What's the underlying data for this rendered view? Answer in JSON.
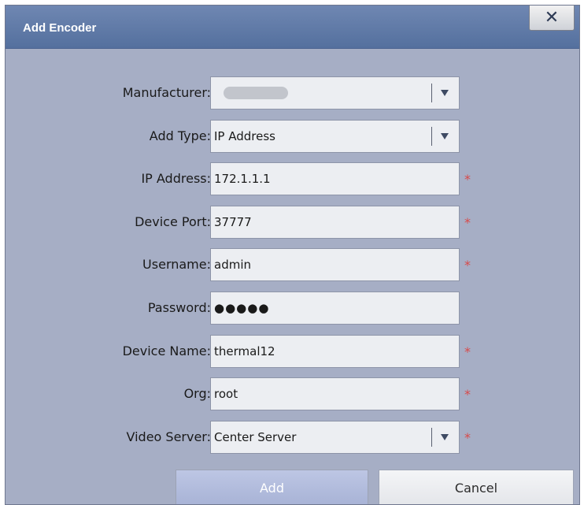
{
  "dialog": {
    "title": "Add Encoder",
    "close_label": "✕"
  },
  "form": {
    "manufacturer_label": "Manufacturer:",
    "add_type_label": "Add Type:",
    "add_type_value": "IP Address",
    "ip_label": "IP Address:",
    "ip_value": "172.1.1.1",
    "port_label": "Device Port:",
    "port_value": "37777",
    "username_label": "Username:",
    "username_value": "admin",
    "password_label": "Password:",
    "password_value": "●●●●●",
    "device_name_label": "Device Name:",
    "device_name_value": "thermal12",
    "org_label": "Org:",
    "org_value": "root",
    "video_server_label": "Video Server:",
    "video_server_value": "Center Server",
    "required_mark": "*"
  },
  "buttons": {
    "add_label": "Add",
    "cancel_label": "Cancel"
  },
  "colors": {
    "dialog_bg": "#a6aec5",
    "titlebar": "#5f79a8",
    "required": "#d84a4a"
  }
}
